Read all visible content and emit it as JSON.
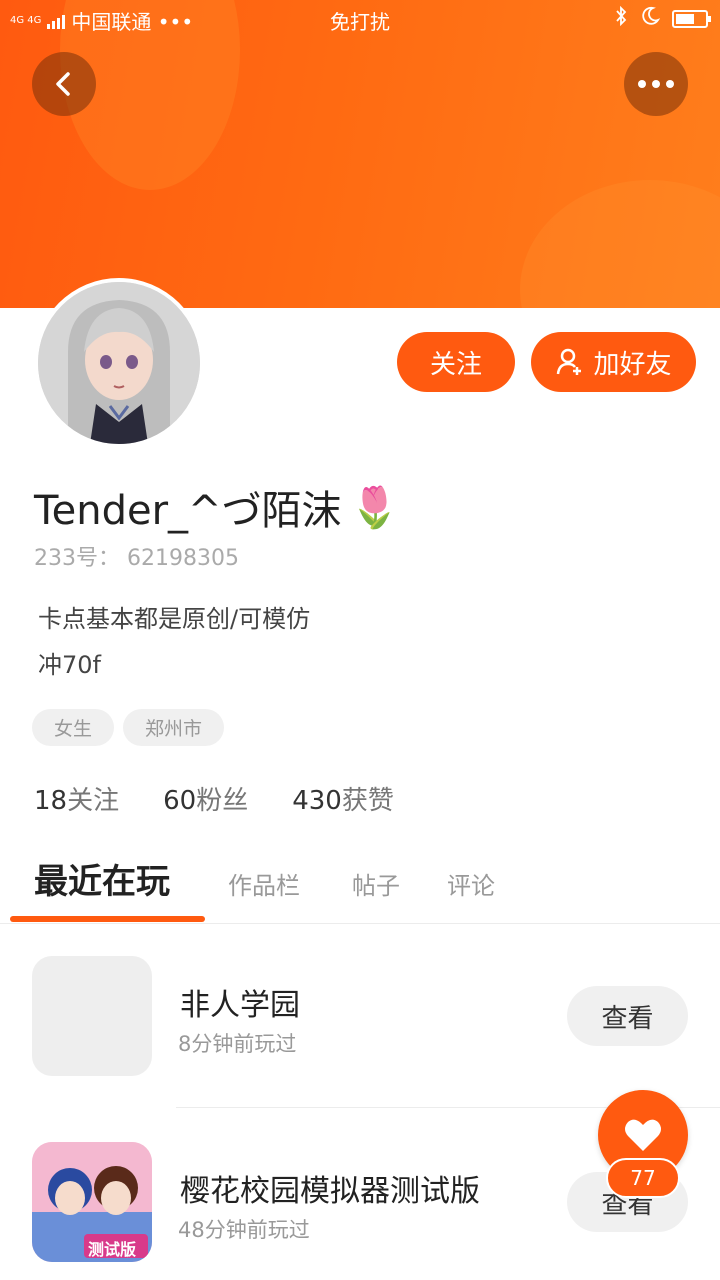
{
  "status_bar": {
    "network": "4G 4G",
    "carrier": "中国联通 •••",
    "mode": "免打扰"
  },
  "header": {
    "back_icon": "chevron-left-icon",
    "more_icon": "more-dots-icon",
    "banner_color": "#ff6a12"
  },
  "profile": {
    "follow_label": "关注",
    "add_friend_label": "加好友",
    "username": "Tender_^づ陌沫",
    "username_emoji": "🌷",
    "uid": "233号： 62198305",
    "bio_line1": "卡点基本都是原创/可模仿",
    "bio_line2": "冲70f",
    "tags": [
      "女生",
      "郑州市"
    ],
    "stats": {
      "following_count": "18",
      "following_label": "关注",
      "fans_count": "60",
      "fans_label": "粉丝",
      "likes_count": "430",
      "likes_label": "获赞"
    }
  },
  "tabs": [
    "最近在玩",
    "作品栏",
    "帖子",
    "评论"
  ],
  "games": [
    {
      "name": "非人学园",
      "time": "8分钟前玩过",
      "action": "查看"
    },
    {
      "name": "樱花校园模拟器测试版",
      "time": "48分钟前玩过",
      "action": "查看",
      "icon_badge": "测试版"
    }
  ],
  "like_fab": {
    "count": "77"
  },
  "accent_color": "#ff5a10"
}
